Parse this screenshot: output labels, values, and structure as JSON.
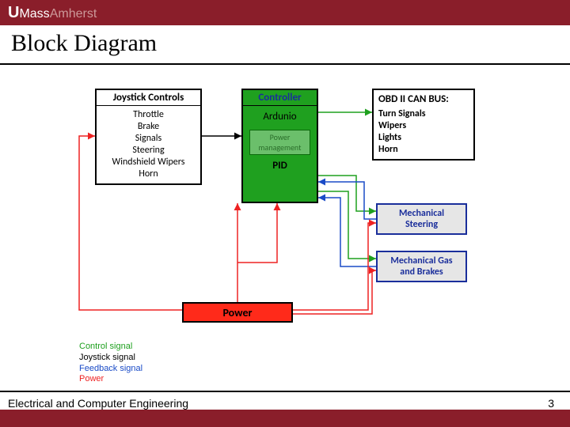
{
  "logo": {
    "u": "U",
    "mass": "Mass",
    "amherst": "Amherst"
  },
  "title": "Block Diagram",
  "blocks": {
    "joystick": {
      "title": "Joystick Controls",
      "items": [
        "Throttle",
        "Brake",
        "Signals",
        "Steering",
        "Windshield Wipers",
        "Horn"
      ]
    },
    "controller": {
      "title": "Controller",
      "main": "Ardunio",
      "power_mgmt": "Power management",
      "pid": "PID"
    },
    "obd": {
      "title": "OBD II CAN BUS:",
      "items": [
        "Turn Signals",
        "Wipers",
        "Lights",
        "Horn"
      ]
    },
    "mech_steering": "Mechanical Steering",
    "mech_gas": "Mechanical Gas and Brakes",
    "power": "Power"
  },
  "legend": {
    "control": "Control signal",
    "joystick": "Joystick signal",
    "feedback": "Feedback signal",
    "power": "Power"
  },
  "footer": {
    "dept": "Electrical and Computer Engineering",
    "page": "3"
  }
}
